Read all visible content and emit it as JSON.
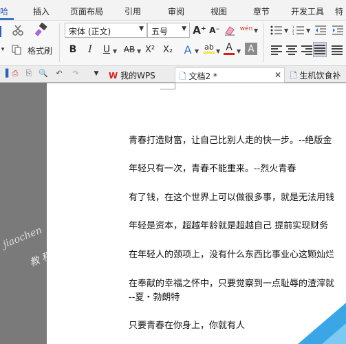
{
  "menu": {
    "partial_first": "哈",
    "items": [
      "插入",
      "页面布局",
      "引用",
      "审阅",
      "视图",
      "章节",
      "开发工具"
    ],
    "overflow_label": "特"
  },
  "ribbon": {
    "format_painter_label": "格式刷",
    "font_name": "宋体 (正文)",
    "font_size": "五号",
    "style_chars": {
      "bold": "B",
      "italic": "I",
      "underline": "U",
      "strikethrough": "AB",
      "superscript": "X²",
      "subscript": "X₂",
      "text_effect": "A",
      "highlight": "ab",
      "font_color": "A",
      "char_shade": "A",
      "grow_font": "A⁺",
      "shrink_font": "A⁻",
      "pinyin": "wén"
    },
    "colors": {
      "font_color_bar": "#d22020",
      "highlight_bar": "#f5e33a",
      "accent": "#3b72c8"
    }
  },
  "tabs": {
    "items": [
      {
        "label": "我的WPS",
        "active": false
      },
      {
        "label": "文档2 *",
        "active": true
      },
      {
        "label": "生机饮食补",
        "active": false
      }
    ]
  },
  "document": {
    "paragraphs": [
      "青春打造财富，让自己比别人走的快一步。--绝版金",
      "年轻只有一次，青春不能重来。--烈火青春",
      "有了钱，在这个世界上可以做很多事，就是无法用钱",
      "年轻是资本，超越年龄就是超越自己  提前实现财务",
      "在年轻人的颈项上，没有什么东西比事业心这颗灿烂",
      "在奉献的幸福之怀中，只要觉察到一点耻辱的渣滓就",
      "--夏・勃朗特",
      "只要青春在你身上，你就有人"
    ],
    "watermark": "jiaochen",
    "watermark2": "教 程"
  }
}
